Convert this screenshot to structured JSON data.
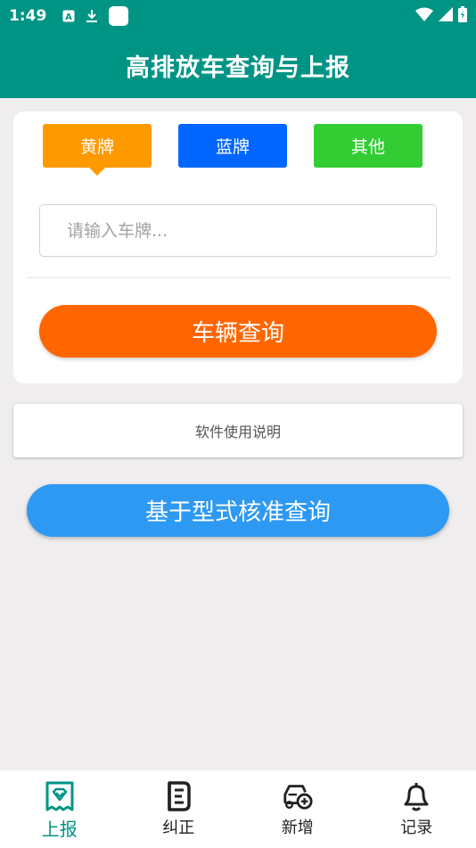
{
  "status_bar": {
    "time": "1:49",
    "icons": [
      "text-notification-icon",
      "download-icon",
      "app-notification-icon",
      "wifi-icon",
      "signal-icon",
      "battery-icon"
    ]
  },
  "app_bar": {
    "title": "高排放车查询与上报"
  },
  "plate_selector": {
    "options": [
      {
        "label": "黄牌",
        "color": "#ff9900",
        "selected": true
      },
      {
        "label": "蓝牌",
        "color": "#0066ff",
        "selected": false
      },
      {
        "label": "其他",
        "color": "#33cc33",
        "selected": false
      }
    ]
  },
  "search": {
    "placeholder": "请输入车牌...",
    "value": ""
  },
  "buttons": {
    "vehicle_query": "车辆查询",
    "manual": "软件使用说明",
    "type_approval_query": "基于型式核准查询"
  },
  "bottom_nav": {
    "items": [
      {
        "label": "上报",
        "icon": "report-ticket-icon",
        "active": true
      },
      {
        "label": "纠正",
        "icon": "correct-list-icon",
        "active": false
      },
      {
        "label": "新增",
        "icon": "add-vehicle-icon",
        "active": false
      },
      {
        "label": "记录",
        "icon": "bell-icon",
        "active": false
      }
    ]
  },
  "colors": {
    "primary": "#009485",
    "query_button": "#ff6600",
    "type_query_button": "#2e99f2",
    "background": "#efedee"
  }
}
